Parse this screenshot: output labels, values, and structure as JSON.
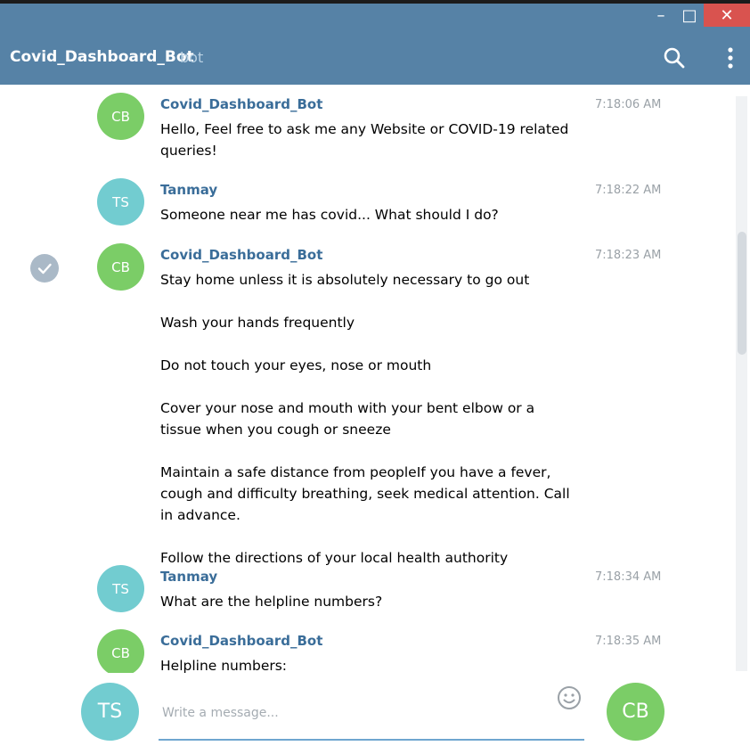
{
  "window": {
    "minimize_glyph": "–",
    "maximize_glyph": "□",
    "close_glyph": "✕"
  },
  "header": {
    "title": "Covid_Dashboard_Bot",
    "tag": "bot",
    "icons": [
      "search-icon",
      "more-vertical-icon"
    ]
  },
  "messages": [
    {
      "avatar": "CB",
      "sender": "Covid_Dashboard_Bot",
      "time": "7:18:06 AM",
      "text": "Hello, Feel free to ask me any Website or COVID-19 related queries!"
    },
    {
      "avatar": "TS",
      "sender": "Tanmay",
      "time": "7:18:22 AM",
      "text": "Someone near me has covid... What should I do?"
    },
    {
      "avatar": "CB",
      "sender": "Covid_Dashboard_Bot",
      "time": "7:18:23 AM",
      "selected": true,
      "text": "Stay home unless it is absolutely necessary to go out\n\nWash your hands frequently\n\nDo not touch your eyes, nose or mouth\n\nCover your nose and mouth with your bent elbow or a tissue when you cough or sneeze\n\nMaintain a safe distance from peopleIf you have a fever, cough and difficulty breathing, seek medical attention. Call in advance.\n\nFollow the directions of your local health authority"
    },
    {
      "avatar": "TS",
      "sender": "Tanmay",
      "time": "7:18:34 AM",
      "text": "What are the helpline numbers?"
    },
    {
      "avatar": "CB",
      "sender": "Covid_Dashboard_Bot",
      "time": "7:18:35 AM",
      "text": "Helpline numbers:"
    }
  ],
  "composer": {
    "self_avatar": "TS",
    "placeholder": "Write a message...",
    "send_avatar": "CB"
  },
  "colors": {
    "header_bg": "#5682a6",
    "bot_avatar": "#7bcd67",
    "user_avatar": "#72ccd0",
    "sender_name": "#3a6d99",
    "close_button": "#d9534f"
  }
}
